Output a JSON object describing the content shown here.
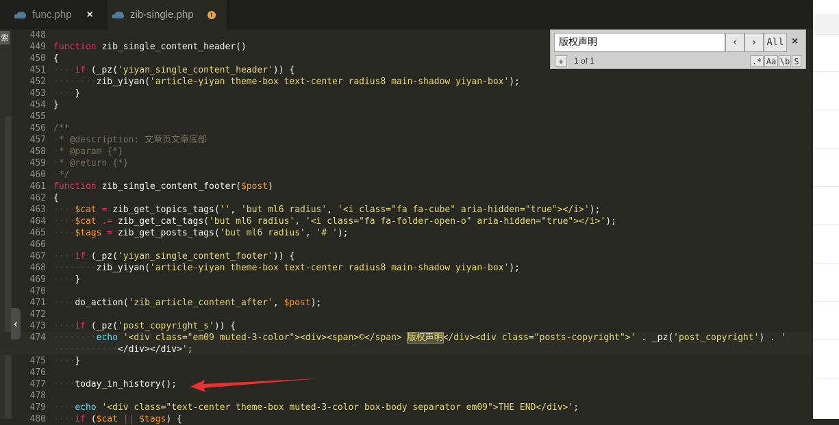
{
  "tabs": [
    {
      "label": "func.php",
      "close_icon": "×",
      "active": false
    },
    {
      "label": "zib-single.php",
      "dirty_icon": "!",
      "active": true
    }
  ],
  "left_panel": {
    "label": "索",
    "collapse_glyph": "‹"
  },
  "find": {
    "query": "版权声明",
    "prev_glyph": "‹",
    "next_glyph": "›",
    "all_label": "All",
    "close_glyph": "×",
    "plus_label": "+",
    "count_text": "1 of 1",
    "regex_label": ".*",
    "case_label": "Aa",
    "word_label": "\\b",
    "selection_label": "S"
  },
  "colors": {
    "background": "#272822",
    "keyword": "#f92672",
    "string": "#e6db74",
    "variable": "#fd971f",
    "comment": "#75715e",
    "builtin": "#66d9ef",
    "arrow": "#e8312f"
  },
  "lines": [
    {
      "num": "448",
      "code": ""
    },
    {
      "num": "449",
      "code": "function zib_single_content_header()"
    },
    {
      "num": "450",
      "code": "{"
    },
    {
      "num": "451",
      "code": "    if (_pz('yiyan_single_content_header')) {"
    },
    {
      "num": "452",
      "code": "        zib_yiyan('article-yiyan theme-box text-center radius8 main-shadow yiyan-box');"
    },
    {
      "num": "453",
      "code": "    }"
    },
    {
      "num": "454",
      "code": "}"
    },
    {
      "num": "455",
      "code": ""
    },
    {
      "num": "456",
      "code": "/**"
    },
    {
      "num": "457",
      "code": " * @description: 文章页文章底部"
    },
    {
      "num": "458",
      "code": " * @param {*}"
    },
    {
      "num": "459",
      "code": " * @return {*}"
    },
    {
      "num": "460",
      "code": " */"
    },
    {
      "num": "461",
      "code": "function zib_single_content_footer($post)"
    },
    {
      "num": "462",
      "code": "{"
    },
    {
      "num": "463",
      "code": "    $cat = zib_get_topics_tags('', 'but ml6 radius', '<i class=\"fa fa-cube\" aria-hidden=\"true\"></i>');"
    },
    {
      "num": "464",
      "code": "    $cat .= zib_get_cat_tags('but ml6 radius', '<i class=\"fa fa-folder-open-o\" aria-hidden=\"true\"></i>');"
    },
    {
      "num": "465",
      "code": "    $tags = zib_get_posts_tags('but ml6 radius', '# ');"
    },
    {
      "num": "466",
      "code": ""
    },
    {
      "num": "467",
      "code": "    if (_pz('yiyan_single_content_footer')) {"
    },
    {
      "num": "468",
      "code": "        zib_yiyan('article-yiyan theme-box text-center radius8 main-shadow yiyan-box');"
    },
    {
      "num": "469",
      "code": "    }"
    },
    {
      "num": "470",
      "code": ""
    },
    {
      "num": "471",
      "code": "    do_action('zib_article_content_after', $post);"
    },
    {
      "num": "472",
      "code": ""
    },
    {
      "num": "473",
      "code": "    if (_pz('post_copyright_s')) {"
    },
    {
      "num": "474",
      "code": "        echo '<div class=\"em09 muted-3-color\"><div><span>©</span> 版权声明</div><div class=\"posts-copyright\">' . _pz('post_copyright') . '"
    },
    {
      "num": "",
      "code": "            </div></div>';"
    },
    {
      "num": "475",
      "code": "    }"
    },
    {
      "num": "476",
      "code": ""
    },
    {
      "num": "477",
      "code": "    today_in_history();"
    },
    {
      "num": "478",
      "code": ""
    },
    {
      "num": "479",
      "code": "    echo '<div class=\"text-center theme-box muted-3-color box-body separator em09\">THE END</div>';"
    },
    {
      "num": "480",
      "code": "    if ($cat || $tags) {"
    }
  ]
}
